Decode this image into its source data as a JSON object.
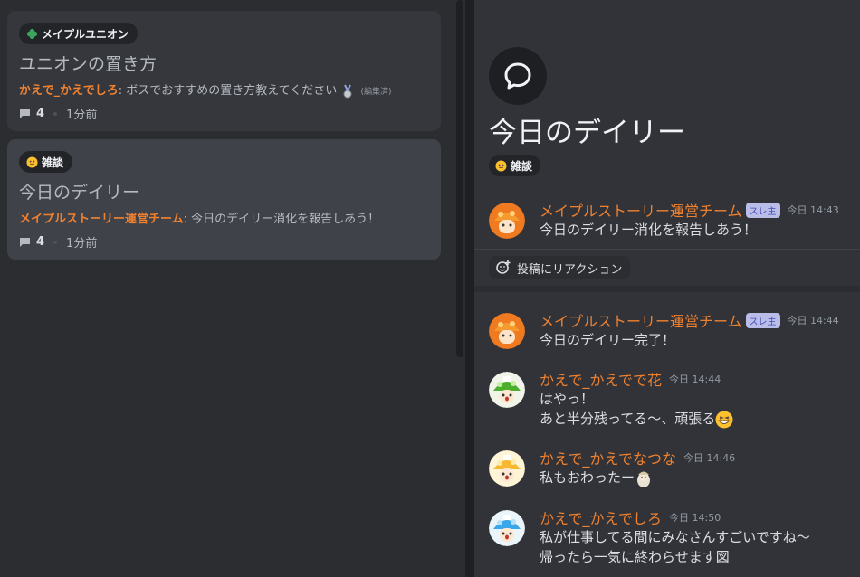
{
  "forum_list": {
    "posts": [
      {
        "tag": "メイプルユニオン",
        "tag_icon": "clover-icon",
        "title": "ユニオンの置き方",
        "author": "かえで_かえでしろ",
        "preview": "ボスでおすすめの置き方教えてください",
        "edited": "(編集済)",
        "count": "4",
        "time": "1分前"
      },
      {
        "tag": "雑談",
        "tag_icon": "smiley-icon",
        "title": "今日のデイリー",
        "author": "メイプルストーリー運営チーム",
        "preview": "今日のデイリー消化を報告しあう！",
        "count": "4",
        "time": "1分前"
      }
    ]
  },
  "thread": {
    "title": "今日のデイリー",
    "tag": "雑談",
    "op_message": {
      "author": "メイプルストーリー運営チーム",
      "op_badge": "スレ主",
      "time": "今日 14:43",
      "text": "今日のデイリー消化を報告しあう！"
    },
    "reaction_button": "投稿にリアクション",
    "messages": [
      {
        "author": "メイプルストーリー運営チーム",
        "op_badge": "スレ主",
        "time": "今日 14:44",
        "lines": [
          "今日のデイリー完了！"
        ]
      },
      {
        "author": "かえで_かえでで花",
        "time": "今日 14:44",
        "lines": [
          "はやっ！",
          "あと半分残ってる〜、頑張る"
        ]
      },
      {
        "author": "かえで_かえでなつな",
        "time": "今日 14:46",
        "lines": [
          "私もおわったー"
        ]
      },
      {
        "author": "かえで_かえでしろ",
        "time": "今日 14:50",
        "lines": [
          "私が仕事してる間にみなさんすごいですね〜",
          "帰ったら一気に終わらせます図"
        ]
      }
    ]
  },
  "colors": {
    "accent_orange": "#f0812f",
    "background": "#313338"
  }
}
